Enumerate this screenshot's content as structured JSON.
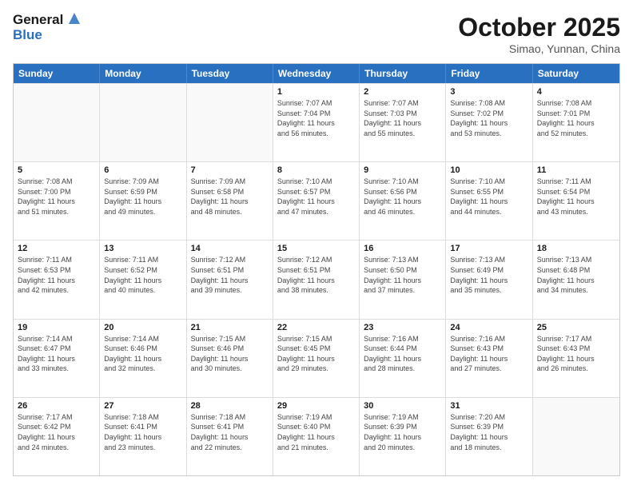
{
  "header": {
    "logo_line1": "General",
    "logo_line2": "Blue",
    "month": "October 2025",
    "location": "Simao, Yunnan, China"
  },
  "days_of_week": [
    "Sunday",
    "Monday",
    "Tuesday",
    "Wednesday",
    "Thursday",
    "Friday",
    "Saturday"
  ],
  "weeks": [
    [
      {
        "day": "",
        "info": ""
      },
      {
        "day": "",
        "info": ""
      },
      {
        "day": "",
        "info": ""
      },
      {
        "day": "1",
        "info": "Sunrise: 7:07 AM\nSunset: 7:04 PM\nDaylight: 11 hours\nand 56 minutes."
      },
      {
        "day": "2",
        "info": "Sunrise: 7:07 AM\nSunset: 7:03 PM\nDaylight: 11 hours\nand 55 minutes."
      },
      {
        "day": "3",
        "info": "Sunrise: 7:08 AM\nSunset: 7:02 PM\nDaylight: 11 hours\nand 53 minutes."
      },
      {
        "day": "4",
        "info": "Sunrise: 7:08 AM\nSunset: 7:01 PM\nDaylight: 11 hours\nand 52 minutes."
      }
    ],
    [
      {
        "day": "5",
        "info": "Sunrise: 7:08 AM\nSunset: 7:00 PM\nDaylight: 11 hours\nand 51 minutes."
      },
      {
        "day": "6",
        "info": "Sunrise: 7:09 AM\nSunset: 6:59 PM\nDaylight: 11 hours\nand 49 minutes."
      },
      {
        "day": "7",
        "info": "Sunrise: 7:09 AM\nSunset: 6:58 PM\nDaylight: 11 hours\nand 48 minutes."
      },
      {
        "day": "8",
        "info": "Sunrise: 7:10 AM\nSunset: 6:57 PM\nDaylight: 11 hours\nand 47 minutes."
      },
      {
        "day": "9",
        "info": "Sunrise: 7:10 AM\nSunset: 6:56 PM\nDaylight: 11 hours\nand 46 minutes."
      },
      {
        "day": "10",
        "info": "Sunrise: 7:10 AM\nSunset: 6:55 PM\nDaylight: 11 hours\nand 44 minutes."
      },
      {
        "day": "11",
        "info": "Sunrise: 7:11 AM\nSunset: 6:54 PM\nDaylight: 11 hours\nand 43 minutes."
      }
    ],
    [
      {
        "day": "12",
        "info": "Sunrise: 7:11 AM\nSunset: 6:53 PM\nDaylight: 11 hours\nand 42 minutes."
      },
      {
        "day": "13",
        "info": "Sunrise: 7:11 AM\nSunset: 6:52 PM\nDaylight: 11 hours\nand 40 minutes."
      },
      {
        "day": "14",
        "info": "Sunrise: 7:12 AM\nSunset: 6:51 PM\nDaylight: 11 hours\nand 39 minutes."
      },
      {
        "day": "15",
        "info": "Sunrise: 7:12 AM\nSunset: 6:51 PM\nDaylight: 11 hours\nand 38 minutes."
      },
      {
        "day": "16",
        "info": "Sunrise: 7:13 AM\nSunset: 6:50 PM\nDaylight: 11 hours\nand 37 minutes."
      },
      {
        "day": "17",
        "info": "Sunrise: 7:13 AM\nSunset: 6:49 PM\nDaylight: 11 hours\nand 35 minutes."
      },
      {
        "day": "18",
        "info": "Sunrise: 7:13 AM\nSunset: 6:48 PM\nDaylight: 11 hours\nand 34 minutes."
      }
    ],
    [
      {
        "day": "19",
        "info": "Sunrise: 7:14 AM\nSunset: 6:47 PM\nDaylight: 11 hours\nand 33 minutes."
      },
      {
        "day": "20",
        "info": "Sunrise: 7:14 AM\nSunset: 6:46 PM\nDaylight: 11 hours\nand 32 minutes."
      },
      {
        "day": "21",
        "info": "Sunrise: 7:15 AM\nSunset: 6:46 PM\nDaylight: 11 hours\nand 30 minutes."
      },
      {
        "day": "22",
        "info": "Sunrise: 7:15 AM\nSunset: 6:45 PM\nDaylight: 11 hours\nand 29 minutes."
      },
      {
        "day": "23",
        "info": "Sunrise: 7:16 AM\nSunset: 6:44 PM\nDaylight: 11 hours\nand 28 minutes."
      },
      {
        "day": "24",
        "info": "Sunrise: 7:16 AM\nSunset: 6:43 PM\nDaylight: 11 hours\nand 27 minutes."
      },
      {
        "day": "25",
        "info": "Sunrise: 7:17 AM\nSunset: 6:43 PM\nDaylight: 11 hours\nand 26 minutes."
      }
    ],
    [
      {
        "day": "26",
        "info": "Sunrise: 7:17 AM\nSunset: 6:42 PM\nDaylight: 11 hours\nand 24 minutes."
      },
      {
        "day": "27",
        "info": "Sunrise: 7:18 AM\nSunset: 6:41 PM\nDaylight: 11 hours\nand 23 minutes."
      },
      {
        "day": "28",
        "info": "Sunrise: 7:18 AM\nSunset: 6:41 PM\nDaylight: 11 hours\nand 22 minutes."
      },
      {
        "day": "29",
        "info": "Sunrise: 7:19 AM\nSunset: 6:40 PM\nDaylight: 11 hours\nand 21 minutes."
      },
      {
        "day": "30",
        "info": "Sunrise: 7:19 AM\nSunset: 6:39 PM\nDaylight: 11 hours\nand 20 minutes."
      },
      {
        "day": "31",
        "info": "Sunrise: 7:20 AM\nSunset: 6:39 PM\nDaylight: 11 hours\nand 18 minutes."
      },
      {
        "day": "",
        "info": ""
      }
    ]
  ]
}
